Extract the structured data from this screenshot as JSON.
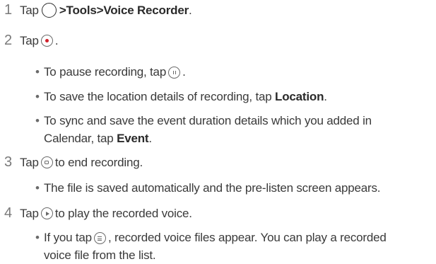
{
  "steps": [
    {
      "number": "1",
      "parts": {
        "tap": "Tap",
        "path_sep1": " > ",
        "tools": "Tools",
        "path_sep2": " > ",
        "voice_recorder": "Voice Recorder",
        "end": "."
      },
      "icon": "home-circle-icon"
    },
    {
      "number": "2",
      "parts": {
        "tap": "Tap",
        "end": "."
      },
      "icon": "record-icon",
      "bullets": [
        {
          "pre": "To pause recording, tap",
          "post": ".",
          "icon": "pause-icon"
        },
        {
          "pre": "To save the location details of recording, tap ",
          "bold": "Location",
          "post": "."
        },
        {
          "line1": "To sync and save the event duration details which you added in",
          "line2_pre": "Calendar, tap ",
          "bold": "Event",
          "post": "."
        }
      ]
    },
    {
      "number": "3",
      "parts": {
        "tap": "Tap",
        "post": "to end recording."
      },
      "icon": "stop-icon",
      "bullets": [
        {
          "text": "The file is saved automatically and the pre-listen screen appears."
        }
      ]
    },
    {
      "number": "4",
      "parts": {
        "tap": "Tap",
        "post": "to play the recorded voice."
      },
      "icon": "play-icon",
      "bullets": [
        {
          "pre": "If you tap",
          "post": ", recorded voice files appear. You can play a recorded",
          "line2": "voice file from the list.",
          "icon": "list-icon"
        }
      ]
    }
  ],
  "colors": {
    "text": "#3a3a3a",
    "bold": "#2a2a2a",
    "record_dot": "#d0202a",
    "step_number": "#7a7a7a"
  }
}
